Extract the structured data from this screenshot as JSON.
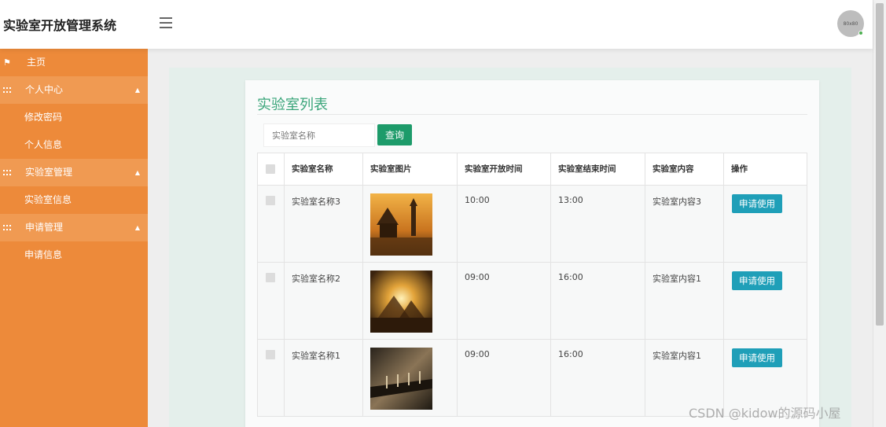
{
  "app": {
    "title": "实验室开放管理系统",
    "avatar_text": "80x80"
  },
  "sidebar": {
    "items": [
      {
        "label": "主页",
        "type": "item"
      },
      {
        "label": "个人中心",
        "type": "group"
      },
      {
        "label": "修改密码",
        "type": "sub"
      },
      {
        "label": "个人信息",
        "type": "sub"
      },
      {
        "label": "实验室管理",
        "type": "group"
      },
      {
        "label": "实验室信息",
        "type": "sub"
      },
      {
        "label": "申请管理",
        "type": "group"
      },
      {
        "label": "申请信息",
        "type": "sub"
      }
    ]
  },
  "main": {
    "title": "实验室列表",
    "search": {
      "placeholder": "实验室名称",
      "button_label": "查询"
    },
    "table": {
      "headers": [
        "实验室名称",
        "实验室图片",
        "实验室开放时间",
        "实验室结束时间",
        "实验室内容",
        "操作"
      ],
      "rows": [
        {
          "name": "实验室名称3",
          "open": "10:00",
          "close": "13:00",
          "content": "实验室内容3",
          "action": "申请使用"
        },
        {
          "name": "实验室名称2",
          "open": "09:00",
          "close": "16:00",
          "content": "实验室内容1",
          "action": "申请使用"
        },
        {
          "name": "实验室名称1",
          "open": "09:00",
          "close": "16:00",
          "content": "实验室内容1",
          "action": "申请使用"
        }
      ]
    }
  },
  "watermark": "CSDN @kidow的源码小屋"
}
